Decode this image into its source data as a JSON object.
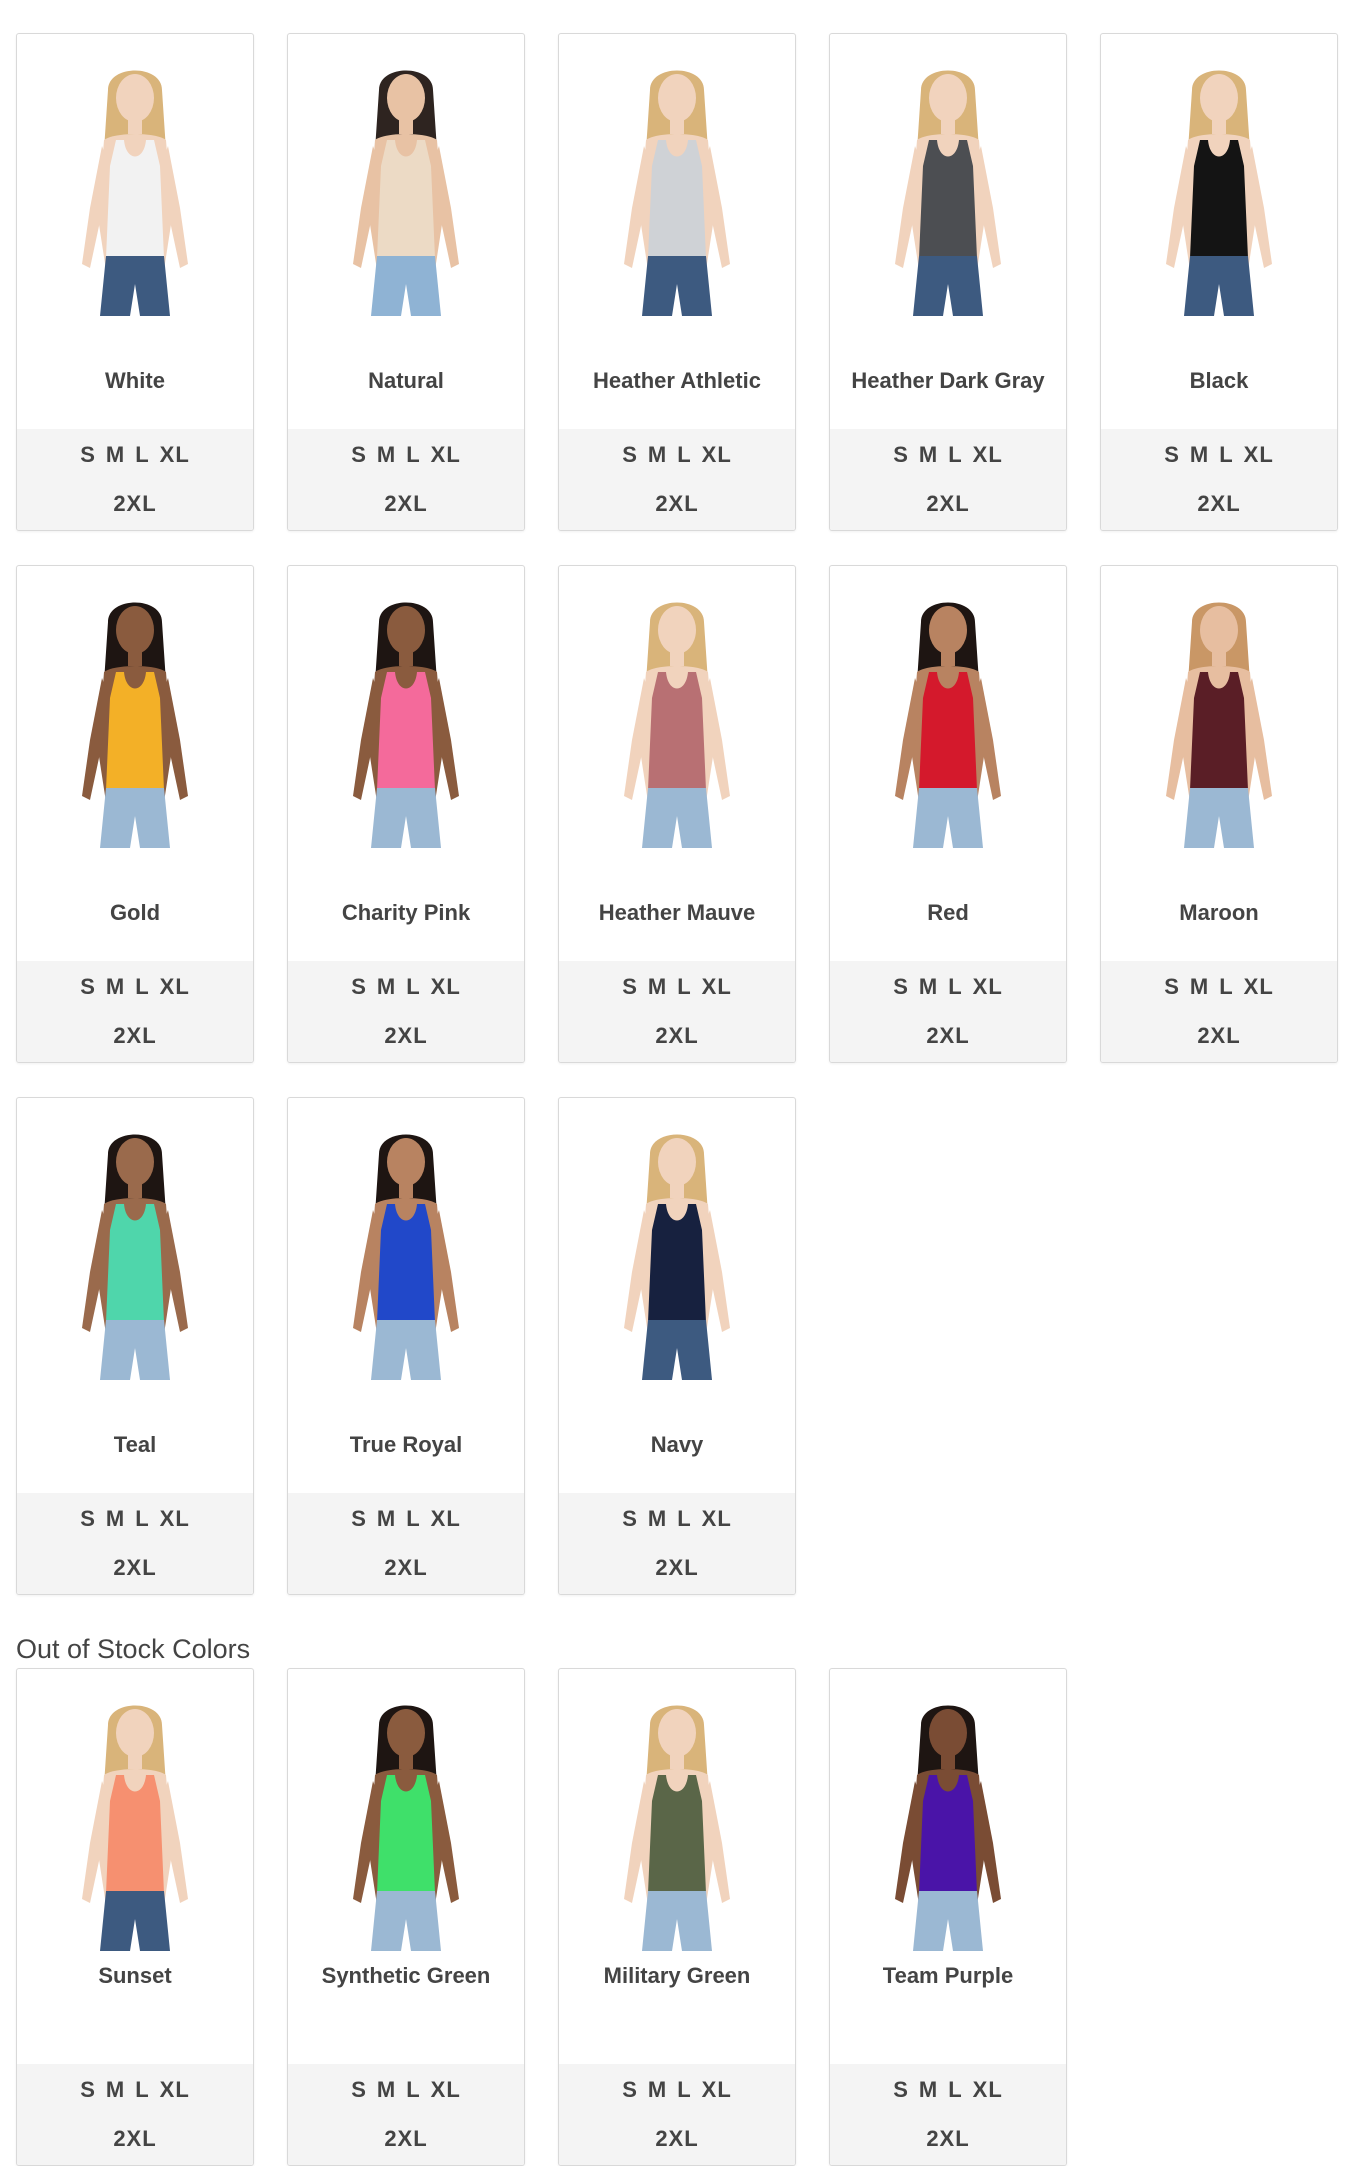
{
  "in_stock": [
    {
      "name": "White",
      "shirt": "#f2f2f2",
      "skin": "#f1d3bd",
      "hair": "#d9b47a",
      "jeans": "#3d5a80"
    },
    {
      "name": "Natural",
      "shirt": "#ecdac5",
      "skin": "#e8c2a4",
      "hair": "#2e2420",
      "jeans": "#8fb3d4"
    },
    {
      "name": "Heather Athletic",
      "shirt": "#cfd2d6",
      "skin": "#f1d3bd",
      "hair": "#d9b47a",
      "jeans": "#3d5a80"
    },
    {
      "name": "Heather Dark Gray",
      "shirt": "#4c4e52",
      "skin": "#f1d3bd",
      "hair": "#d9b47a",
      "jeans": "#3d5a80"
    },
    {
      "name": "Black",
      "shirt": "#141414",
      "skin": "#f1d3bd",
      "hair": "#d9b47a",
      "jeans": "#3d5a80"
    },
    {
      "name": "Gold",
      "shirt": "#f3b027",
      "skin": "#8a5b3e",
      "hair": "#1e1512",
      "jeans": "#9bb8d3"
    },
    {
      "name": "Charity Pink",
      "shirt": "#f46a9b",
      "skin": "#8a5b3e",
      "hair": "#1e1512",
      "jeans": "#9bb8d3"
    },
    {
      "name": "Heather Mauve",
      "shirt": "#b87073",
      "skin": "#f1d3bd",
      "hair": "#d9b47a",
      "jeans": "#9bb8d3"
    },
    {
      "name": "Red",
      "shirt": "#d4192c",
      "skin": "#b88361",
      "hair": "#1e1512",
      "jeans": "#9bb8d3"
    },
    {
      "name": "Maroon",
      "shirt": "#5a1e26",
      "skin": "#e7bea0",
      "hair": "#c99766",
      "jeans": "#9bb8d3"
    },
    {
      "name": "Teal",
      "shirt": "#4fd6ab",
      "skin": "#9a6a4c",
      "hair": "#1e1512",
      "jeans": "#9bb8d3"
    },
    {
      "name": "True Royal",
      "shirt": "#2148c9",
      "skin": "#b88361",
      "hair": "#1e1512",
      "jeans": "#9bb8d3"
    },
    {
      "name": "Navy",
      "shirt": "#17213f",
      "skin": "#f1d3bd",
      "hair": "#d9b47a",
      "jeans": "#3d5a80"
    }
  ],
  "out_of_stock_title": "Out of Stock Colors",
  "out_of_stock": [
    {
      "name": "Sunset",
      "shirt": "#f69070",
      "skin": "#f1d3bd",
      "hair": "#d9b47a",
      "jeans": "#3d5a80"
    },
    {
      "name": "Synthetic Green",
      "shirt": "#3fe06a",
      "skin": "#8a5b3e",
      "hair": "#1e1512",
      "jeans": "#9bb8d3"
    },
    {
      "name": "Military Green",
      "shirt": "#5a6648",
      "skin": "#f1d3bd",
      "hair": "#d9b47a",
      "jeans": "#9bb8d3"
    },
    {
      "name": "Team Purple",
      "shirt": "#4a14a8",
      "skin": "#7a4c34",
      "hair": "#1e1512",
      "jeans": "#9bb8d3"
    }
  ],
  "sizes_row1": [
    "S",
    "M",
    "L",
    "XL"
  ],
  "sizes_row2": [
    "2XL"
  ],
  "image_icon": "model-tank-top-icon"
}
